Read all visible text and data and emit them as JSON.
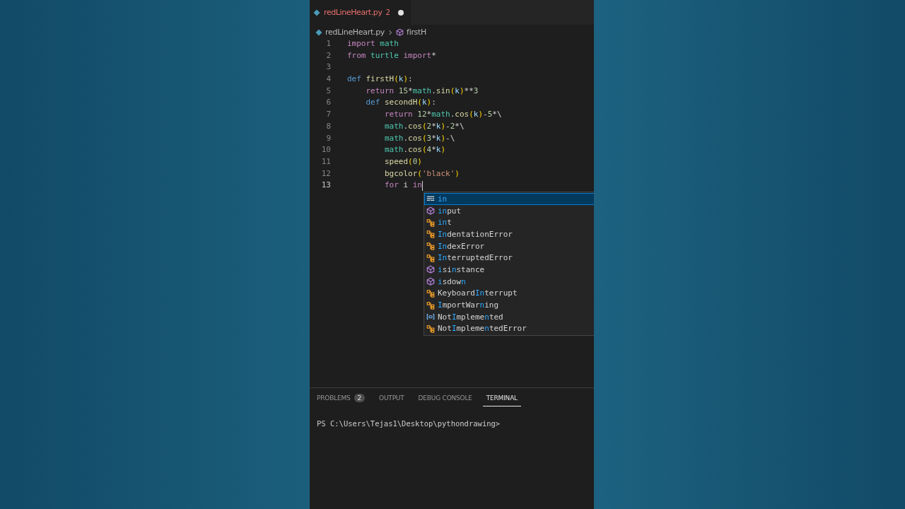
{
  "tab": {
    "title": "redLineHeart.py",
    "problems": "2",
    "modified": true
  },
  "breadcrumb": {
    "file": "redLineHeart.py",
    "symbol": "firstH"
  },
  "lines": [
    {
      "number": "1",
      "current": false,
      "tokens": [
        {
          "text": "import",
          "kind": "kw"
        },
        {
          "text": " math",
          "kind": "module"
        }
      ]
    },
    {
      "number": "2",
      "current": false,
      "tokens": [
        {
          "text": "from",
          "kind": "kw"
        },
        {
          "text": " turtle",
          "kind": "module"
        },
        {
          "text": " import",
          "kind": "kw"
        },
        {
          "text": "*",
          "kind": "plain"
        }
      ]
    },
    {
      "number": "3",
      "current": false
    },
    {
      "number": "4",
      "current": false,
      "tokens": [
        {
          "text": "def",
          "kind": "storage"
        },
        {
          "text": " firstH",
          "kind": "fn"
        },
        {
          "text": "(",
          "kind": "bracket"
        },
        {
          "text": "k",
          "kind": "param"
        },
        {
          "text": ")",
          "kind": "bracket"
        },
        {
          "text": ":",
          "kind": "plain"
        }
      ]
    },
    {
      "number": "5",
      "current": false,
      "tokens": [
        {
          "text": "    return",
          "kind": "kw"
        },
        {
          "text": " 15",
          "kind": "num"
        },
        {
          "text": "*",
          "kind": "plain"
        },
        {
          "text": "math",
          "kind": "module"
        },
        {
          "text": ".",
          "kind": "plain"
        },
        {
          "text": "sin",
          "kind": "fn"
        },
        {
          "text": "(",
          "kind": "bracket"
        },
        {
          "text": "k",
          "kind": "param"
        },
        {
          "text": ")",
          "kind": "bracket"
        },
        {
          "text": "**",
          "kind": "plain"
        },
        {
          "text": "3",
          "kind": "num"
        }
      ]
    },
    {
      "number": "6",
      "current": false,
      "tokens": [
        {
          "text": "    def",
          "kind": "storage"
        },
        {
          "text": " secondH",
          "kind": "fn"
        },
        {
          "text": "(",
          "kind": "bracket"
        },
        {
          "text": "k",
          "kind": "param"
        },
        {
          "text": ")",
          "kind": "bracket"
        },
        {
          "text": ":",
          "kind": "plain"
        }
      ]
    },
    {
      "number": "7",
      "current": false,
      "tokens": [
        {
          "text": "        return",
          "kind": "kw"
        },
        {
          "text": " 12",
          "kind": "num"
        },
        {
          "text": "*",
          "kind": "plain"
        },
        {
          "text": "math",
          "kind": "module"
        },
        {
          "text": ".",
          "kind": "plain"
        },
        {
          "text": "cos",
          "kind": "fn"
        },
        {
          "text": "(",
          "kind": "bracket"
        },
        {
          "text": "k",
          "kind": "param"
        },
        {
          "text": ")",
          "kind": "bracket"
        },
        {
          "text": "-",
          "kind": "plain"
        },
        {
          "text": "5",
          "kind": "num"
        },
        {
          "text": "*\\",
          "kind": "plain"
        }
      ]
    },
    {
      "number": "8",
      "current": false,
      "tokens": [
        {
          "text": "        math",
          "kind": "module"
        },
        {
          "text": ".",
          "kind": "plain"
        },
        {
          "text": "cos",
          "kind": "fn"
        },
        {
          "text": "(",
          "kind": "bracket"
        },
        {
          "text": "2",
          "kind": "num"
        },
        {
          "text": "*",
          "kind": "plain"
        },
        {
          "text": "k",
          "kind": "param"
        },
        {
          "text": ")",
          "kind": "bracket"
        },
        {
          "text": "-",
          "kind": "plain"
        },
        {
          "text": "2",
          "kind": "num"
        },
        {
          "text": "*\\",
          "kind": "plain"
        }
      ]
    },
    {
      "number": "9",
      "current": false,
      "tokens": [
        {
          "text": "        math",
          "kind": "module"
        },
        {
          "text": ".",
          "kind": "plain"
        },
        {
          "text": "cos",
          "kind": "fn"
        },
        {
          "text": "(",
          "kind": "bracket"
        },
        {
          "text": "3",
          "kind": "num"
        },
        {
          "text": "*",
          "kind": "plain"
        },
        {
          "text": "k",
          "kind": "param"
        },
        {
          "text": ")",
          "kind": "bracket"
        },
        {
          "text": "-\\",
          "kind": "plain"
        }
      ]
    },
    {
      "number": "10",
      "current": false,
      "tokens": [
        {
          "text": "        math",
          "kind": "module"
        },
        {
          "text": ".",
          "kind": "plain"
        },
        {
          "text": "cos",
          "kind": "fn"
        },
        {
          "text": "(",
          "kind": "bracket"
        },
        {
          "text": "4",
          "kind": "num"
        },
        {
          "text": "*",
          "kind": "plain"
        },
        {
          "text": "k",
          "kind": "param"
        },
        {
          "text": ")",
          "kind": "bracket"
        }
      ]
    },
    {
      "number": "11",
      "current": false,
      "tokens": [
        {
          "text": "        speed",
          "kind": "fn"
        },
        {
          "text": "(",
          "kind": "bracket"
        },
        {
          "text": "0",
          "kind": "num"
        },
        {
          "text": ")",
          "kind": "bracket"
        }
      ]
    },
    {
      "number": "12",
      "current": false,
      "tokens": [
        {
          "text": "        bgcolor",
          "kind": "fn"
        },
        {
          "text": "(",
          "kind": "bracket"
        },
        {
          "text": "'black'",
          "kind": "str"
        },
        {
          "text": ")",
          "kind": "bracket"
        }
      ]
    },
    {
      "number": "13",
      "current": true,
      "tokens": [
        {
          "text": "        for",
          "kind": "kw"
        },
        {
          "text": " i",
          "kind": "plain"
        },
        {
          "text": " in",
          "kind": "kw"
        }
      ]
    }
  ],
  "suggestions": [
    {
      "label": "**in**",
      "kind": "keyword",
      "selected": true
    },
    {
      "label": "**in**put",
      "kind": "method",
      "selected": false
    },
    {
      "label": "**in**t",
      "kind": "class",
      "selected": false
    },
    {
      "label": "**In**dentationError",
      "kind": "class",
      "selected": false
    },
    {
      "label": "**In**dexError",
      "kind": "class",
      "selected": false
    },
    {
      "label": "**In**terruptedError",
      "kind": "class",
      "selected": false
    },
    {
      "label": "**i**si**n**stance",
      "kind": "method",
      "selected": false
    },
    {
      "label": "**i**sdow**n**",
      "kind": "method",
      "selected": false
    },
    {
      "label": "Keyboard**In**terrupt",
      "kind": "class",
      "selected": false
    },
    {
      "label": "**I**mportWar**n**ing",
      "kind": "class",
      "selected": false
    },
    {
      "label": "Not**I**mpleme**n**ted",
      "kind": "field",
      "selected": false
    },
    {
      "label": "Not**I**mpleme**n**tedError",
      "kind": "class",
      "selected": false
    }
  ],
  "panel_tabs": [
    {
      "label": "PROBLEMS",
      "badge": "2",
      "selected": false
    },
    {
      "label": "OUTPUT",
      "selected": false
    },
    {
      "label": "DEBUG CONSOLE",
      "selected": false
    },
    {
      "label": "TERMINAL",
      "selected": true
    }
  ],
  "terminal": {
    "prompt": "PS C:\\Users\\Tejas1\\Desktop\\pythondrawing>"
  }
}
